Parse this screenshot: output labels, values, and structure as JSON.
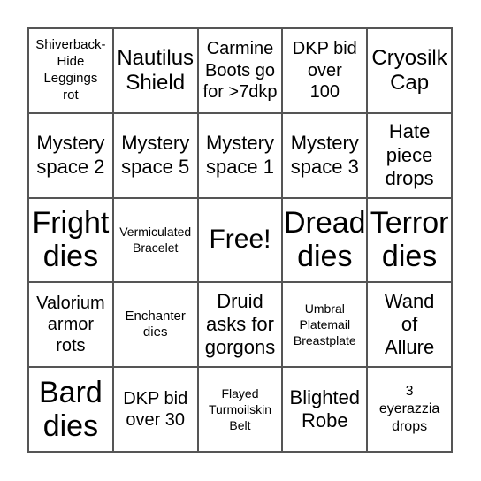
{
  "board": {
    "cells": [
      "Shiverback-Hide Leggings rot",
      "Nautilus Shield",
      "Carmine Boots go for >7dkp",
      "DKP bid over 100",
      "Cryosilk Cap",
      "Mystery space 2",
      "Mystery space 5",
      "Mystery space 1",
      "Mystery space 3",
      "Hate piece drops",
      "Fright dies",
      "Vermiculated Bracelet",
      "Free!",
      "Dread dies",
      "Terror dies",
      "Valorium armor rots",
      "Enchanter dies",
      "Druid asks for gorgons",
      "Umbral Platemail Breastplate",
      "Wand of Allure",
      "Bard dies",
      "DKP bid over 30",
      "Flayed Turmoilskin Belt",
      "Blighted Robe",
      "3 eyerazzia drops"
    ]
  }
}
